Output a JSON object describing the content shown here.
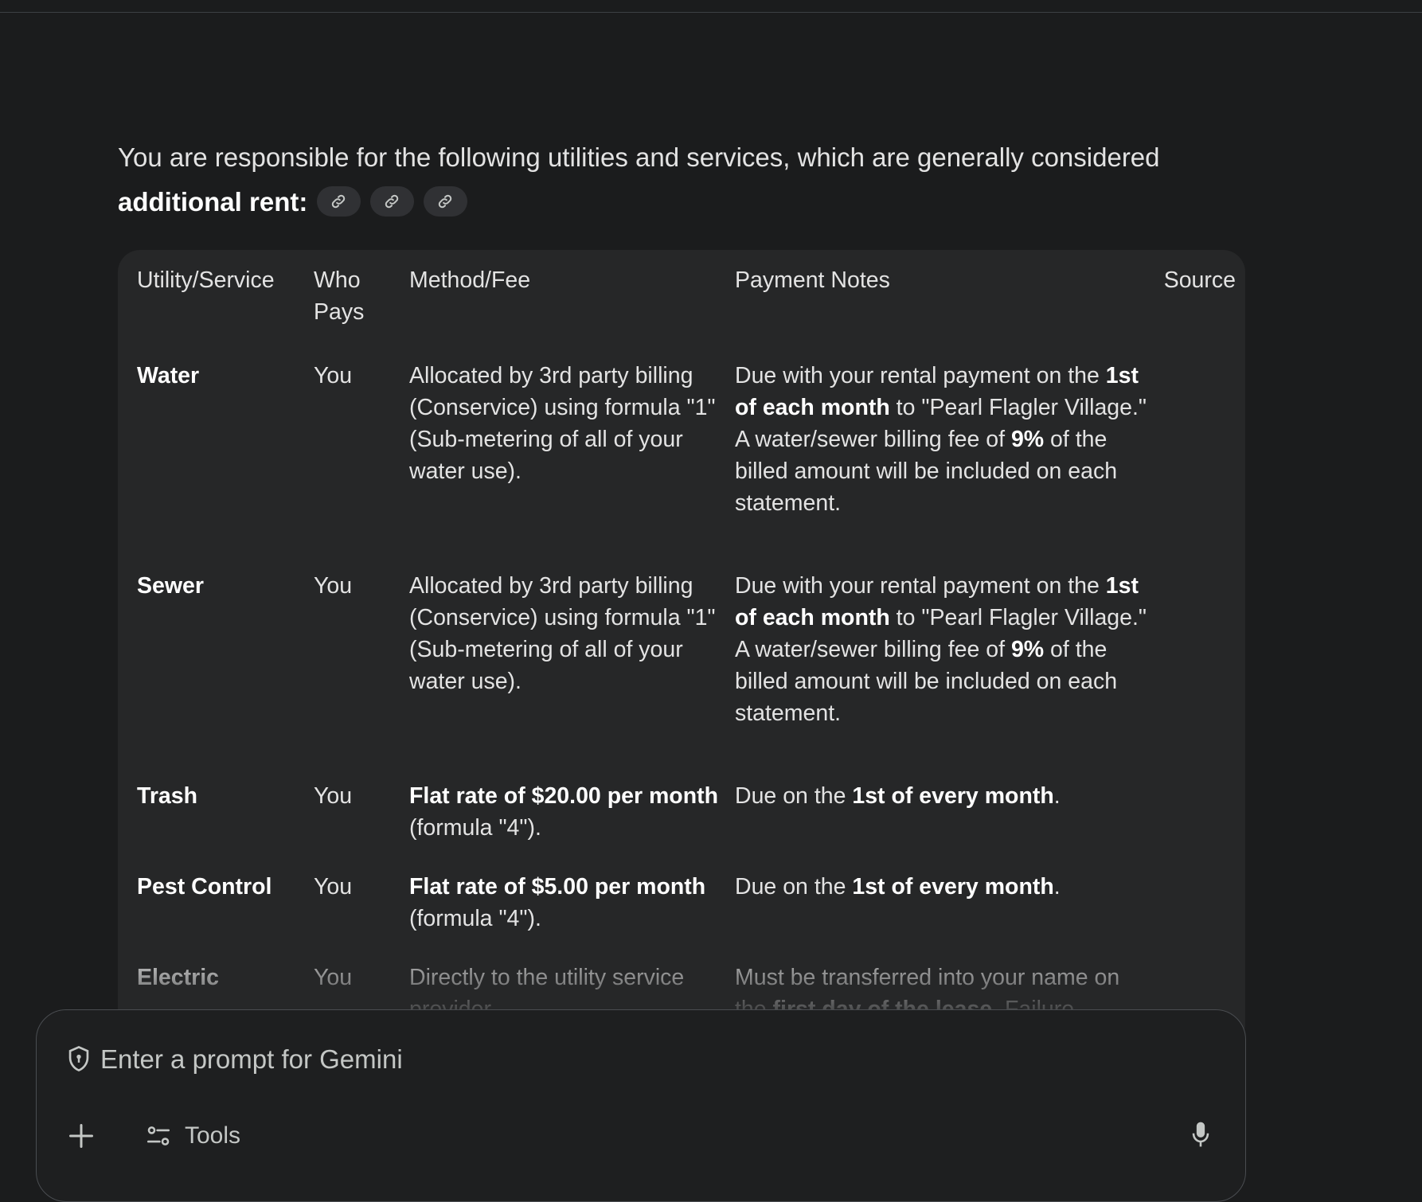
{
  "intro": {
    "text": "You are responsible for the following utilities and services, which are generally considered ",
    "bold": "additional rent",
    "suffix": ":"
  },
  "source_chips": [
    "link-icon",
    "link-icon",
    "link-icon"
  ],
  "table": {
    "headers": {
      "service": "Utility/Service",
      "who_pays": "Who Pays",
      "method": "Method/Fee",
      "notes": "Payment Notes",
      "source": "Source"
    },
    "rows": [
      {
        "service": "Water",
        "who_pays": "You",
        "method": [
          {
            "t": "Allocated by 3rd party billing (Conservice) using formula \"1\" (Sub-metering of all of your water use).",
            "b": false
          }
        ],
        "notes": [
          {
            "t": "Due with your rental payment on the ",
            "b": false
          },
          {
            "t": "1st of each month",
            "b": true
          },
          {
            "t": " to \"Pearl Flagler Village.\" A water/sewer billing fee of ",
            "b": false
          },
          {
            "t": "9%",
            "b": true
          },
          {
            "t": " of the billed amount will be included on each statement.",
            "b": false
          }
        ]
      },
      {
        "service": "Sewer",
        "who_pays": "You",
        "method": [
          {
            "t": "Allocated by 3rd party billing (Conservice) using formula \"1\" (Sub-metering of all of your water use).",
            "b": false
          }
        ],
        "notes": [
          {
            "t": "Due with your rental payment on the ",
            "b": false
          },
          {
            "t": "1st of each month",
            "b": true
          },
          {
            "t": " to \"Pearl Flagler Village.\" A water/sewer billing fee of ",
            "b": false
          },
          {
            "t": "9%",
            "b": true
          },
          {
            "t": " of the billed amount will be included on each statement.",
            "b": false
          }
        ]
      },
      {
        "service": "Trash",
        "who_pays": "You",
        "method": [
          {
            "t": "Flat rate of $20.00 per month",
            "b": true
          },
          {
            "t": " (formula \"4\").",
            "b": false
          }
        ],
        "notes": [
          {
            "t": "Due on the ",
            "b": false
          },
          {
            "t": "1st of every month",
            "b": true
          },
          {
            "t": ".",
            "b": false
          }
        ]
      },
      {
        "service": "Pest Control",
        "who_pays": "You",
        "method": [
          {
            "t": "Flat rate of $5.00 per month",
            "b": true
          },
          {
            "t": " (formula \"4\").",
            "b": false
          }
        ],
        "notes": [
          {
            "t": "Due on the ",
            "b": false
          },
          {
            "t": "1st of every month",
            "b": true
          },
          {
            "t": ".",
            "b": false
          }
        ]
      },
      {
        "service": "Electric",
        "who_pays": "You",
        "method": [
          {
            "t": "Directly to the utility service provider.",
            "b": false
          }
        ],
        "notes": [
          {
            "t": "Must be transferred into your name on the ",
            "b": false
          },
          {
            "t": "first day of the lease",
            "b": true
          },
          {
            "t": ". Failure",
            "b": false
          }
        ]
      }
    ]
  },
  "prompt": {
    "placeholder": "Enter a prompt for Gemini",
    "tools_label": "Tools"
  },
  "colors": {
    "background": "#1b1c1d",
    "card": "#262728",
    "text": "#e3e3e3",
    "muted": "#c4c7c5"
  }
}
